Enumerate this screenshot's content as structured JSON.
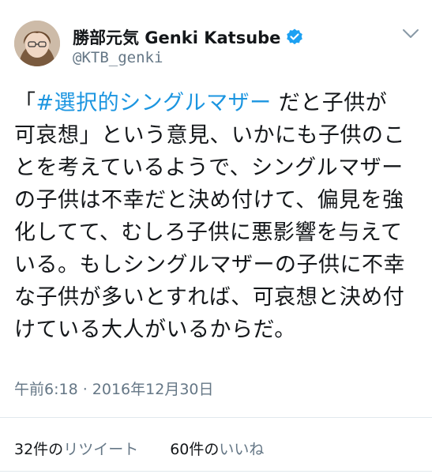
{
  "author": {
    "display_name": "勝部元気 Genki Katsube",
    "handle": "@KTB_genki"
  },
  "icons": {
    "verified": "verified-badge-icon",
    "menu": "chevron-down-icon",
    "avatar": "profile-avatar"
  },
  "tweet": {
    "hashtag": "#選択的シングルマザー",
    "lines": [
      "「",
      " だと子供が",
      "可哀想」という意見、いかにも子供のこ",
      "とを考えているようで、シングルマザー",
      "の子供は不幸だと決め付けて、偏見を強",
      "化してて、むしろ子供に悪影響を与えて",
      "いる。もしシングルマザーの子供に不幸",
      "な子供が多いとすれば、可哀想と決め付",
      "けている大人がいるからだ。"
    ]
  },
  "timestamp": "午前6:18 · 2016年12月30日",
  "stats": {
    "retweets_count": "32件の",
    "retweets_label": "リツイート",
    "likes_count": "60件の",
    "likes_label": "いいね"
  },
  "colors": {
    "link": "#1b95e0",
    "secondary_text": "#657786",
    "divider": "#e1e8ed",
    "verified": "#1da1f2"
  }
}
